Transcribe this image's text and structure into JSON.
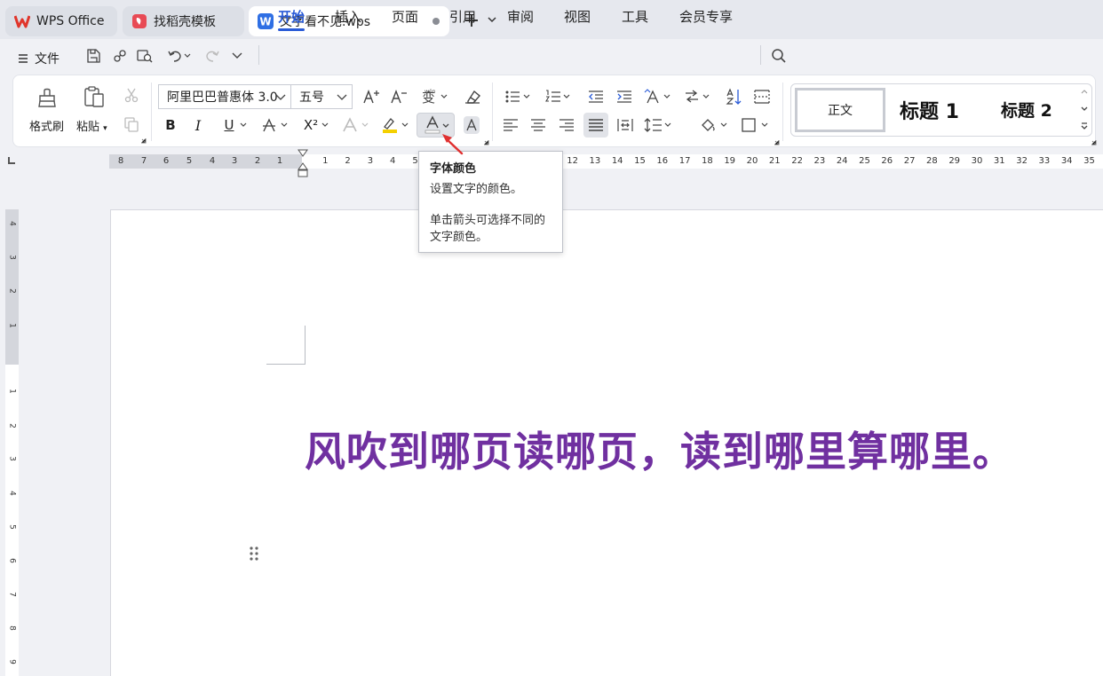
{
  "tabs": [
    {
      "label": "WPS Office",
      "icon": "wps-logo-icon"
    },
    {
      "label": "找稻壳模板",
      "icon": "docer-icon"
    },
    {
      "label": "文字看不见.wps",
      "icon": "writer-doc-icon",
      "active": true
    }
  ],
  "menu": {
    "file": "文件",
    "items": [
      "开始",
      "插入",
      "页面",
      "引用",
      "审阅",
      "视图",
      "工具",
      "会员专享"
    ],
    "active": "开始"
  },
  "ribbon": {
    "format_painter": "格式刷",
    "paste": "粘贴",
    "font_name": "阿里巴巴普惠体 3.0",
    "font_size": "五号",
    "bold": "B",
    "italic": "I",
    "underline": "U",
    "superscript": "X²",
    "styles": {
      "normal": "正文",
      "heading1": "标题 1",
      "heading2": "标题 2"
    }
  },
  "colors": {
    "accent": "#2a5bd7",
    "doc_text": "#7030a0",
    "highlight": "#f4d000",
    "arrow": "#e03030"
  },
  "ruler": {
    "left_ticks": [
      "8",
      "7",
      "6",
      "5",
      "4",
      "3",
      "2",
      "1"
    ],
    "right_ticks": [
      "1",
      "2",
      "3",
      "4",
      "5",
      "12",
      "13",
      "14",
      "15",
      "16",
      "17",
      "18",
      "19",
      "20",
      "21",
      "22",
      "23",
      "24",
      "25",
      "26",
      "27",
      "28",
      "29",
      "30",
      "31",
      "32",
      "33",
      "34",
      "35"
    ]
  },
  "vruler": {
    "ticks": [
      "4",
      "3",
      "2",
      "1",
      "1",
      "2",
      "3",
      "4",
      "5",
      "6",
      "7",
      "8",
      "9"
    ]
  },
  "tooltip": {
    "title": "字体颜色",
    "desc1": "设置文字的颜色。",
    "desc2": "单击箭头可选择不同的文字颜色。"
  },
  "document": {
    "text": "风吹到哪页读哪页，读到哪里算哪里。"
  }
}
